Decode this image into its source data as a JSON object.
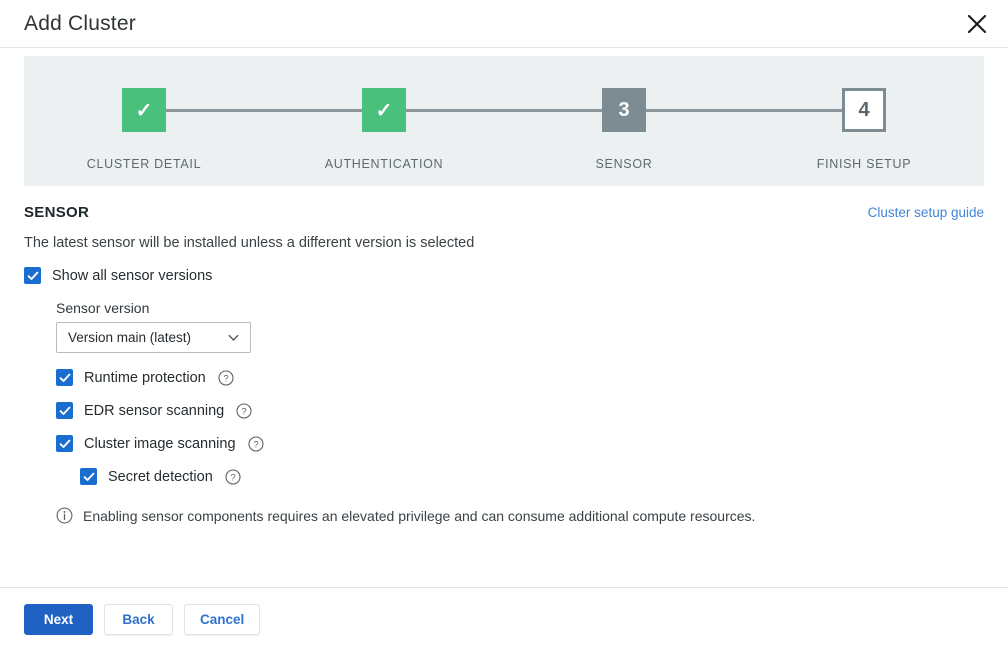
{
  "header": {
    "title": "Add Cluster",
    "close_icon": "close-icon"
  },
  "stepper": {
    "steps": [
      {
        "marker": "✓",
        "label": "CLUSTER DETAIL",
        "state": "done"
      },
      {
        "marker": "✓",
        "label": "AUTHENTICATION",
        "state": "done"
      },
      {
        "marker": "3",
        "label": "SENSOR",
        "state": "active"
      },
      {
        "marker": "4",
        "label": "FINISH SETUP",
        "state": "todo"
      }
    ],
    "colors": {
      "done": "#49c07c",
      "active": "#7d8c93",
      "todo_border": "#7d8c93",
      "connector": "#8b979d",
      "panel_bg": "#edf0f1"
    }
  },
  "section": {
    "title": "SENSOR",
    "guide_link": "Cluster setup guide",
    "description": "The latest sensor will be installed unless a different version is selected"
  },
  "show_all_versions": {
    "label": "Show all sensor versions",
    "checked": true
  },
  "sensor_version": {
    "label": "Sensor version",
    "value": "Version main (latest)",
    "chevron_icon": "chevron-down-icon"
  },
  "options": [
    {
      "label": "Runtime protection",
      "checked": true,
      "help_icon": "help-circle-icon",
      "indent": 1
    },
    {
      "label": "EDR sensor scanning",
      "checked": true,
      "help_icon": "help-circle-icon",
      "indent": 1
    },
    {
      "label": "Cluster image scanning",
      "checked": true,
      "help_icon": "help-circle-icon",
      "indent": 1
    },
    {
      "label": "Secret detection",
      "checked": true,
      "help_icon": "help-circle-icon",
      "indent": 2
    }
  ],
  "note": {
    "icon": "info-circle-icon",
    "text": "Enabling sensor components requires an elevated privilege and can consume additional compute resources."
  },
  "footer": {
    "next_label": "Next",
    "back_label": "Back",
    "cancel_label": "Cancel"
  },
  "colors": {
    "accent_blue": "#2061c4",
    "checkbox_blue": "#1a6ed0",
    "link_blue": "#4285d6",
    "success_green": "#49c07c"
  }
}
